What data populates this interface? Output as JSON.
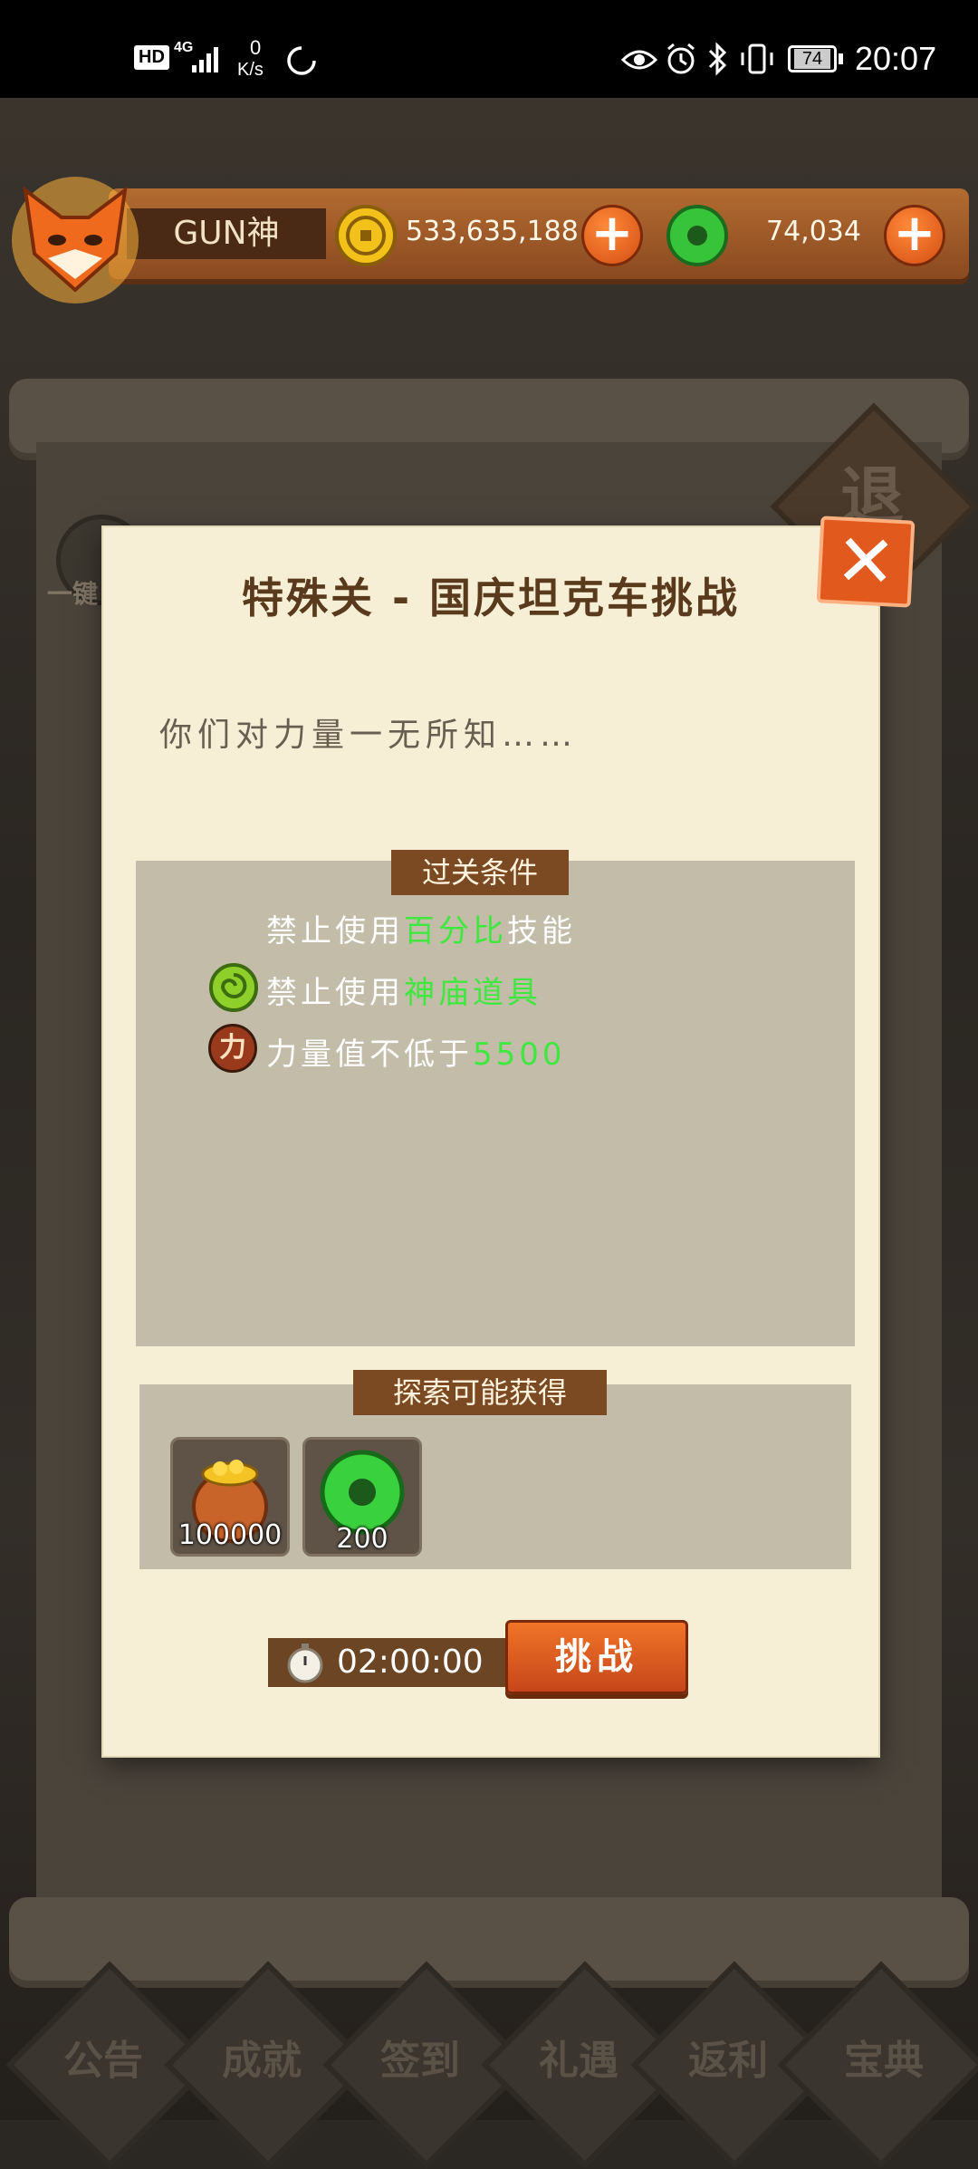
{
  "status_bar": {
    "hd": "HD",
    "network": "4G",
    "speed_value": "0",
    "speed_unit": "K/s",
    "battery": "74",
    "time": "20:07"
  },
  "player": {
    "name": "GUN神",
    "gold": "533,635,188",
    "jade": "74,034"
  },
  "background": {
    "side_button_label": "退",
    "left_button_label": "一键",
    "bottom_tabs": [
      "公告",
      "成就",
      "签到",
      "礼遇",
      "返利",
      "宝典"
    ]
  },
  "dialog": {
    "title": "特殊关 - 国庆坦克车挑战",
    "description": "你们对力量一无所知……",
    "conditions": {
      "header": "过关条件",
      "items": [
        {
          "prefix": "禁止使用",
          "highlight": "百分比",
          "suffix": "技能",
          "icon": "none"
        },
        {
          "prefix": "禁止使用",
          "highlight": "神庙道具",
          "suffix": "",
          "icon": "jade-swirl-icon"
        },
        {
          "prefix": "力量值不低于",
          "highlight": "5500",
          "suffix": "",
          "icon": "power-icon",
          "icon_text": "力"
        }
      ]
    },
    "rewards": {
      "header": "探索可能获得",
      "items": [
        {
          "icon": "gold-bag-icon",
          "count": "100000"
        },
        {
          "icon": "jade-ring-icon",
          "count": "200"
        }
      ]
    },
    "timer": "02:00:00",
    "challenge_button": "挑战"
  },
  "colors": {
    "highlight_green": "#3ee83e",
    "dialog_bg": "#f6efd6",
    "header_brown": "#7b4a22",
    "accent_orange": "#e2591d"
  }
}
